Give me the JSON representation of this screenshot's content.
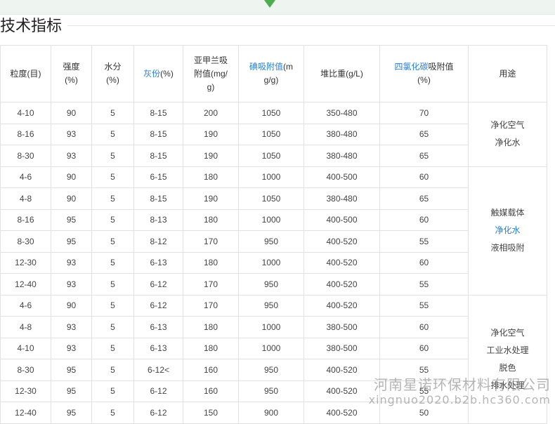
{
  "section_title": "技术指标",
  "headers": {
    "size": [
      "粒度(目)"
    ],
    "strength": [
      "强度",
      "(%)"
    ],
    "moisture": [
      "水分",
      "(%)"
    ],
    "ash_label": "灰份",
    "ash_unit": "(%)",
    "mb": [
      "亚甲兰吸",
      "附值(mg/",
      "g)"
    ],
    "iodine_label": "碘吸附值",
    "iodine_unit_1": "(m",
    "iodine_unit_2": "g/g)",
    "density": [
      "堆比重(g/L)"
    ],
    "ccl4_label": "四氯化碳",
    "ccl4_suffix": "吸附值",
    "ccl4_unit": "(%)",
    "usage": [
      "用途"
    ]
  },
  "groups": [
    {
      "usage": [
        {
          "text": "净化空气",
          "highlight": false
        },
        {
          "text": "净化水",
          "highlight": false
        }
      ],
      "rows": [
        [
          "4-10",
          "90",
          "5",
          "8-15",
          "200",
          "1050",
          "350-480",
          "70"
        ],
        [
          "8-16",
          "93",
          "5",
          "8-15",
          "190",
          "1050",
          "380-480",
          "65"
        ],
        [
          "8-30",
          "93",
          "5",
          "8-15",
          "190",
          "1050",
          "380-480",
          "65"
        ]
      ]
    },
    {
      "usage": [
        {
          "text": "触媒载体",
          "highlight": false
        },
        {
          "text": "净化水",
          "highlight": true
        },
        {
          "text": "液相吸附",
          "highlight": false
        }
      ],
      "rows": [
        [
          "4-6",
          "90",
          "5",
          "6-15",
          "180",
          "1000",
          "400-500",
          "60"
        ],
        [
          "4-8",
          "90",
          "5",
          "8-15",
          "190",
          "1050",
          "380-480",
          "65"
        ],
        [
          "8-16",
          "95",
          "5",
          "8-13",
          "180",
          "1000",
          "400-500",
          "60"
        ],
        [
          "8-30",
          "95",
          "5",
          "8-12",
          "170",
          "950",
          "400-520",
          "55"
        ],
        [
          "12-30",
          "93",
          "5",
          "6-13",
          "180",
          "1000",
          "400-520",
          "60"
        ],
        [
          "12-40",
          "93",
          "5",
          "6-12",
          "170",
          "950",
          "400-520",
          "55"
        ]
      ]
    },
    {
      "usage": [
        {
          "text": "净化空气",
          "highlight": false
        },
        {
          "text": "工业水处理",
          "highlight": false
        },
        {
          "text": "脱色",
          "highlight": false
        },
        {
          "text": "排水处理",
          "highlight": false
        }
      ],
      "rows": [
        [
          "4-6",
          "90",
          "5",
          "6-12",
          "170",
          "950",
          "400-520",
          "55"
        ],
        [
          "4-8",
          "93",
          "5",
          "6-13",
          "180",
          "1000",
          "380-500",
          "60"
        ],
        [
          "4-10",
          "93",
          "5",
          "6-13",
          "180",
          "1000",
          "380-500",
          "60"
        ],
        [
          "8-30",
          "95",
          "5",
          "6-12<",
          "160",
          "950",
          "400-520",
          "55"
        ],
        [
          "12-30",
          "95",
          "5",
          "6-12",
          "160",
          "950",
          "400-520",
          "55"
        ],
        [
          "12-40",
          "95",
          "5",
          "6-12",
          "150",
          "900",
          "400-520",
          "50"
        ]
      ]
    }
  ],
  "watermark": {
    "line1": "河南星诺环保材料有限公司",
    "line2": "xingnuo2020.b2b.hc360.com"
  }
}
